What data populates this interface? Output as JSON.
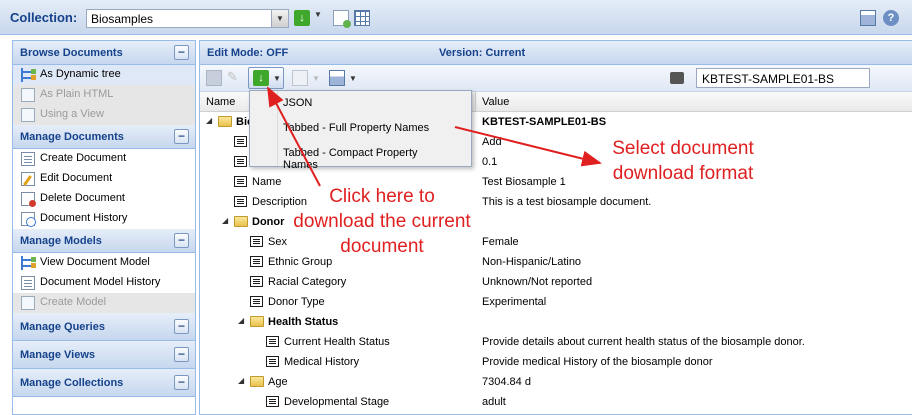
{
  "topbar": {
    "collection_label": "Collection:",
    "collection_value": "Biosamples"
  },
  "sidebar": {
    "sections": [
      {
        "title": "Browse Documents",
        "items": [
          {
            "label": "As Dynamic tree",
            "state": "selected"
          },
          {
            "label": "As Plain HTML",
            "state": "disabled"
          },
          {
            "label": "Using a View",
            "state": "disabled"
          }
        ]
      },
      {
        "title": "Manage Documents",
        "items": [
          {
            "label": "Create Document"
          },
          {
            "label": "Edit Document"
          },
          {
            "label": "Delete Document"
          },
          {
            "label": "Document History"
          }
        ]
      },
      {
        "title": "Manage Models",
        "items": [
          {
            "label": "View Document Model"
          },
          {
            "label": "Document Model History"
          },
          {
            "label": "Create Model",
            "state": "disabled"
          }
        ]
      },
      {
        "title": "Manage Queries"
      },
      {
        "title": "Manage Views"
      },
      {
        "title": "Manage Collections"
      }
    ],
    "collapse_symbol": "−"
  },
  "main": {
    "edit_mode": "Edit Mode: OFF",
    "version": "Version: Current",
    "search_value": "KBTEST-SAMPLE01-BS",
    "columns": {
      "name": "Name",
      "value": "Value"
    },
    "menu": [
      "JSON",
      "Tabbed - Full Property Names",
      "Tabbed - Compact Property Names"
    ],
    "rows": [
      {
        "name": "Bio",
        "value": "KBTEST-SAMPLE01-BS",
        "icon": "folder",
        "level": 0,
        "bold": true,
        "expander": true
      },
      {
        "name": "",
        "value": "Add",
        "icon": "prop",
        "level": 1
      },
      {
        "name": "",
        "value": "0.1",
        "icon": "prop",
        "level": 1
      },
      {
        "name": "Name",
        "value": "Test Biosample 1",
        "icon": "prop",
        "level": 1
      },
      {
        "name": "Description",
        "value": "This is a test biosample document.",
        "icon": "prop",
        "level": 1
      },
      {
        "name": "Donor",
        "value": "",
        "icon": "folder",
        "level": 1,
        "bold": true,
        "expander": true
      },
      {
        "name": "Sex",
        "value": "Female",
        "icon": "prop",
        "level": 2
      },
      {
        "name": "Ethnic Group",
        "value": "Non-Hispanic/Latino",
        "icon": "prop",
        "level": 2
      },
      {
        "name": "Racial Category",
        "value": "Unknown/Not reported",
        "icon": "prop",
        "level": 2
      },
      {
        "name": "Donor Type",
        "value": "Experimental",
        "icon": "prop",
        "level": 2
      },
      {
        "name": "Health Status",
        "value": "",
        "icon": "folder",
        "level": 2,
        "bold": true,
        "expander": true
      },
      {
        "name": "Current Health Status",
        "value": "Provide details about current health status of the biosample donor.",
        "icon": "prop",
        "level": 3
      },
      {
        "name": "Medical History",
        "value": "Provide medical History of the biosample donor",
        "icon": "prop",
        "level": 3
      },
      {
        "name": "Age",
        "value": "7304.84 d",
        "icon": "folder",
        "level": 2,
        "expander": true
      },
      {
        "name": "Developmental Stage",
        "value": "adult",
        "icon": "prop",
        "level": 3
      }
    ]
  },
  "annotations": {
    "left": "Click here to download the current document",
    "right": "Select document download format",
    "color": "#e02020"
  }
}
